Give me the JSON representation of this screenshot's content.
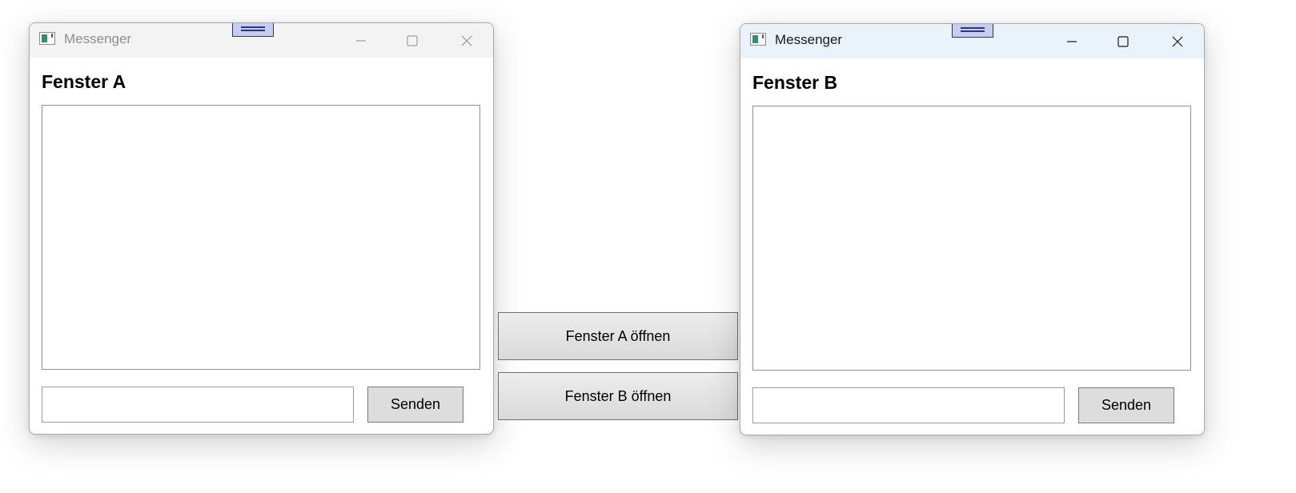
{
  "colors": {
    "titlebar_inactive": "#f3f3f3",
    "titlebar_active": "#eaf3f9",
    "grip_fill": "#c7cdf0",
    "grip_border": "#2b3580",
    "button_face": "#dddddd"
  },
  "window_a": {
    "title": "Messenger",
    "active": false,
    "heading": "Fenster A",
    "message_log": "",
    "input_value": "",
    "send_label": "Senden",
    "icons": [
      "app-icon",
      "minimize-icon",
      "maximize-icon",
      "close-icon"
    ]
  },
  "window_b": {
    "title": "Messenger",
    "active": true,
    "heading": "Fenster B",
    "message_log": "",
    "input_value": "",
    "send_label": "Senden",
    "icons": [
      "app-icon",
      "minimize-icon",
      "maximize-icon",
      "close-icon"
    ]
  },
  "launcher": {
    "open_a_label": "Fenster A öffnen",
    "open_b_label": "Fenster B öffnen"
  }
}
